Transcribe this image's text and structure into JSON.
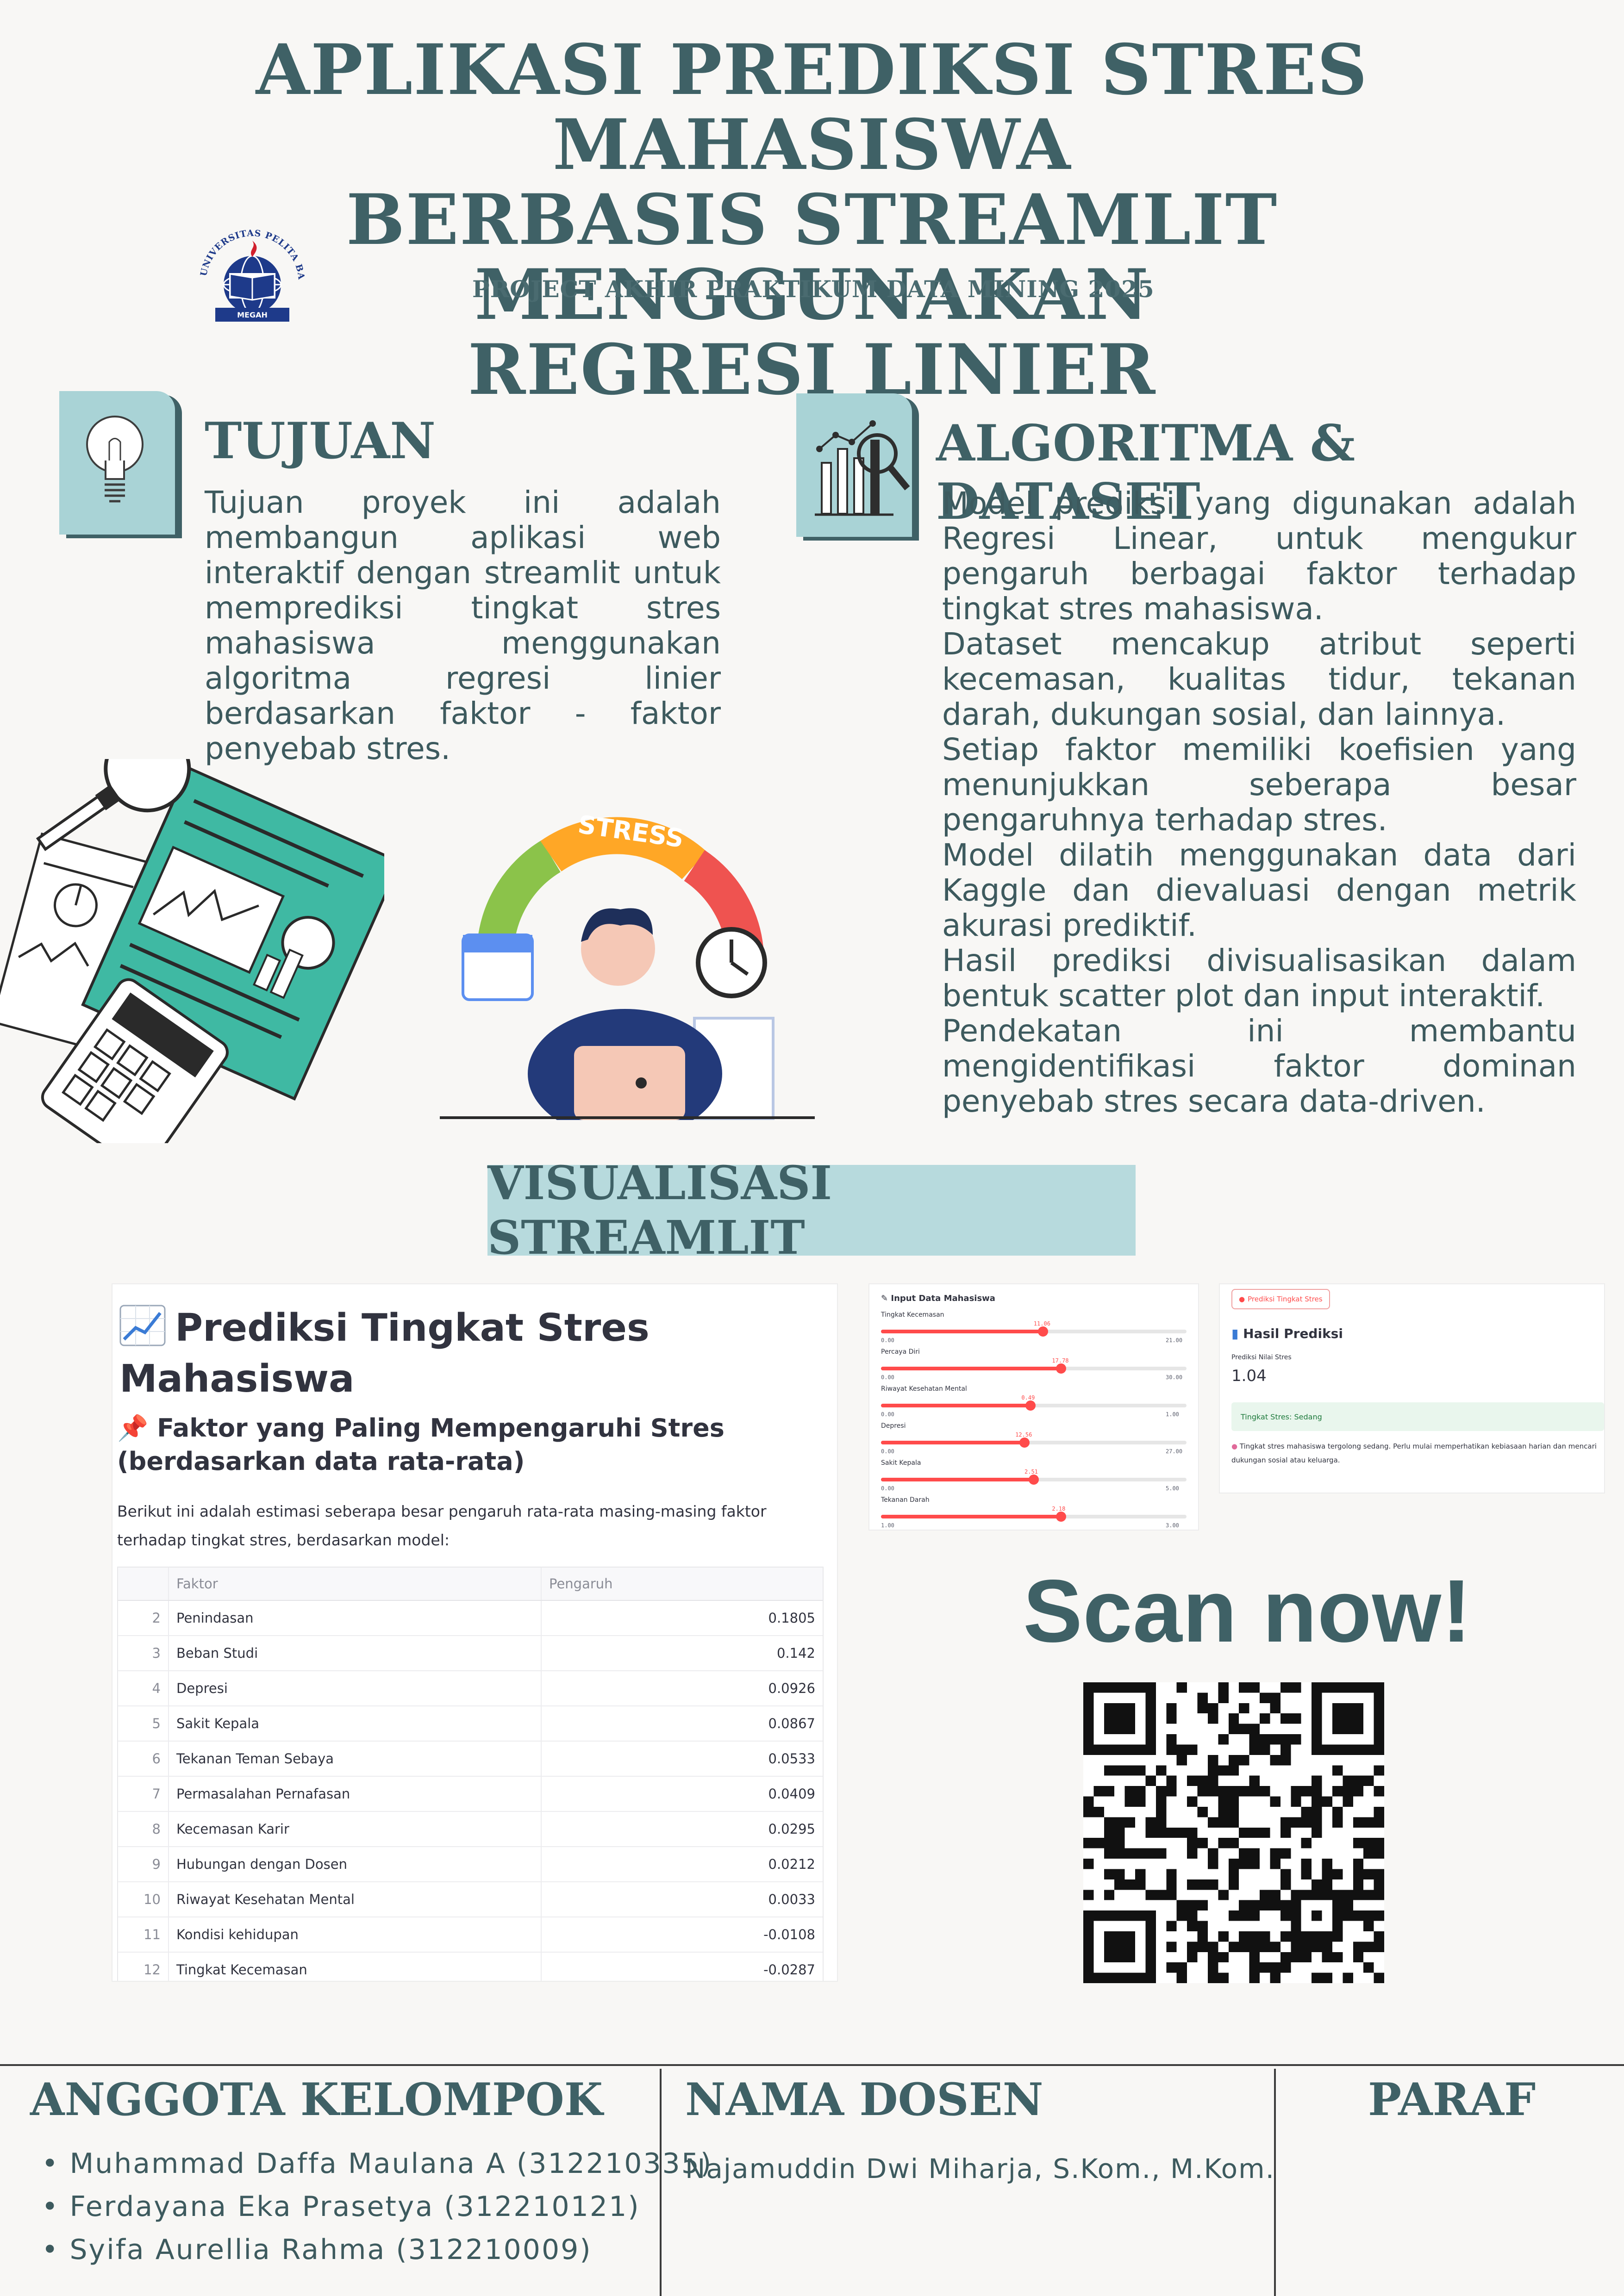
{
  "poster": {
    "title_lines": [
      "APLIKASI PREDIKSI STRES MAHASISWA",
      "BERBASIS STREAMLIT MENGGUNAKAN",
      "REGRESI LINIER"
    ],
    "subtitle": "PROJECT AKHIR PRAKTIKUM DATA MINING 2025",
    "logo": {
      "ring_text": "UNIVERSITAS PELITA BANGSA",
      "ribbon_text": "MEGAH"
    }
  },
  "tujuan": {
    "heading": "TUJUAN",
    "icon": "lightbulb-icon",
    "text": "Tujuan proyek ini adalah membangun aplikasi web interaktif dengan streamlit untuk memprediksi tingkat stres mahasiswa menggunakan algoritma regresi linier berdasarkan faktor - faktor penyebab stres."
  },
  "algoritma": {
    "heading": "ALGORITMA & DATASET",
    "icon": "chart-magnifier-icon",
    "paragraphs": [
      "Model prediksi yang digunakan adalah Regresi Linear, untuk mengukur pengaruh berbagai faktor terhadap tingkat stres mahasiswa.",
      "Dataset mencakup atribut seperti kecemasan, kualitas tidur, tekanan darah, dukungan sosial, dan lainnya.",
      "Setiap faktor memiliki koefisien yang menunjukkan seberapa besar pengaruhnya terhadap stres.",
      "Model dilatih menggunakan data dari Kaggle dan dievaluasi dengan metrik akurasi prediktif.",
      "Hasil prediksi divisualisasikan dalam bentuk scatter plot dan input interaktif.",
      "Pendekatan ini membantu mengidentifikasi faktor dominan penyebab stres secara data-driven."
    ]
  },
  "illustration": {
    "gauge_label": "STRESS"
  },
  "visualisasi": {
    "banner": "VISUALISASI STREAMLIT",
    "app_title_icon": "chart-increasing-icon",
    "app_title": "Prediksi Tingkat Stres Mahasiswa",
    "section_icon": "pushpin-icon",
    "section_title": "Faktor yang Paling Mempengaruhi Stres (berdasarkan data rata-rata)",
    "description": "Berikut ini adalah estimasi seberapa besar pengaruh rata-rata masing-masing faktor terhadap tingkat stres, berdasarkan model:",
    "table": {
      "columns": [
        "Faktor",
        "Pengaruh"
      ],
      "rows": [
        {
          "idx": "2",
          "faktor": "Penindasan",
          "pengaruh": "0.1805"
        },
        {
          "idx": "3",
          "faktor": "Beban Studi",
          "pengaruh": "0.142"
        },
        {
          "idx": "4",
          "faktor": "Depresi",
          "pengaruh": "0.0926"
        },
        {
          "idx": "5",
          "faktor": "Sakit Kepala",
          "pengaruh": "0.0867"
        },
        {
          "idx": "6",
          "faktor": "Tekanan Teman Sebaya",
          "pengaruh": "0.0533"
        },
        {
          "idx": "7",
          "faktor": "Permasalahan Pernafasan",
          "pengaruh": "0.0409"
        },
        {
          "idx": "8",
          "faktor": "Kecemasan Karir",
          "pengaruh": "0.0295"
        },
        {
          "idx": "9",
          "faktor": "Hubungan dengan Dosen",
          "pengaruh": "0.0212"
        },
        {
          "idx": "10",
          "faktor": "Riwayat Kesehatan Mental",
          "pengaruh": "0.0033"
        },
        {
          "idx": "11",
          "faktor": "Kondisi kehidupan",
          "pengaruh": "-0.0108"
        },
        {
          "idx": "12",
          "faktor": "Tingkat Kecemasan",
          "pengaruh": "-0.0287"
        }
      ]
    },
    "input_panel": {
      "title": "Input Data Mahasiswa",
      "icon": "pencil-icon",
      "sliders": [
        {
          "label": "Tingkat Kecemasan",
          "min": "0.00",
          "max": "21.00",
          "value": "11.06",
          "fraction": 0.53
        },
        {
          "label": "Percaya Diri",
          "min": "0.00",
          "max": "30.00",
          "value": "17.78",
          "fraction": 0.59
        },
        {
          "label": "Riwayat Kesehatan Mental",
          "min": "0.00",
          "max": "1.00",
          "value": "0.49",
          "fraction": 0.49
        },
        {
          "label": "Depresi",
          "min": "0.00",
          "max": "27.00",
          "value": "12.56",
          "fraction": 0.47
        },
        {
          "label": "Sakit Kepala",
          "min": "0.00",
          "max": "5.00",
          "value": "2.51",
          "fraction": 0.5
        },
        {
          "label": "Tekanan Darah",
          "min": "1.00",
          "max": "3.00",
          "value": "2.18",
          "fraction": 0.59
        }
      ]
    },
    "result_panel": {
      "button_label": "Prediksi Tingkat Stres",
      "button_icon": "crystal-ball-icon",
      "heading": "Hasil Prediksi",
      "heading_icon": "bar-chart-icon",
      "metric_label": "Prediksi Nilai Stres",
      "metric_value": "1.04",
      "status": "Tingkat Stres: Sedang",
      "note_icon": "brain-icon",
      "note": "Tingkat stres mahasiswa tergolong sedang. Perlu mulai memperhatikan kebiasaan harian dan mencari dukungan sosial atau keluarga."
    },
    "scan": "Scan now!"
  },
  "footer": {
    "anggota_heading": "ANGGOTA KELOMPOK",
    "members": [
      "Muhammad Daffa Maulana A (312210335)",
      "Ferdayana Eka Prasetya (312210121)",
      "Syifa Aurellia Rahma (312210009)"
    ],
    "dosen_heading": "NAMA DOSEN",
    "dosen_name": "Najamuddin Dwi Miharja, S.Kom., M.Kom.",
    "paraf_heading": "PARAF"
  },
  "colors": {
    "teal_dark": "#3f6166",
    "teal_light": "#a9d3d6",
    "accent_green": "#3fb9a3",
    "streamlit_red": "#ff4b4b"
  }
}
